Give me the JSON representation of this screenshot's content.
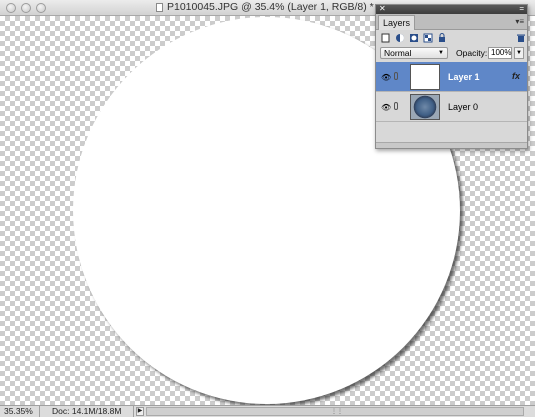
{
  "window": {
    "title": "P1010045.JPG @ 35.4% (Layer 1, RGB/8) *"
  },
  "status": {
    "zoom": "35.35%",
    "doc_size": "Doc: 14.1M/18.8M"
  },
  "layers_panel": {
    "tab": "Layers",
    "blend_mode": "Normal",
    "opacity_label": "Opacity:",
    "opacity_value": "100%",
    "layers": [
      {
        "name": "Layer 1",
        "selected": true,
        "thumbnail": "white",
        "fx_label": "fx"
      },
      {
        "name": "Layer 0",
        "selected": false,
        "thumbnail": "photo"
      }
    ]
  },
  "icons": {
    "close": "close-icon",
    "panel_menu": "panel-menu-icon",
    "eye": "eye-icon",
    "link": "link-icon",
    "trash": "trash-icon"
  },
  "colors": {
    "selection": "#5f87c8"
  }
}
